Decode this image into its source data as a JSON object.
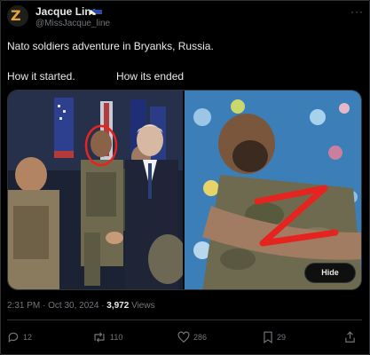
{
  "author": {
    "display_name": "Jacque Line",
    "handle": "@MissJacque_line",
    "avatar_letter": "Z"
  },
  "tweet": {
    "line1": "Nato soldiers adventure in Bryanks, Russia.",
    "label_left": "How it started.",
    "label_right": "How its ended"
  },
  "media": {
    "hide_label": "Hide"
  },
  "meta": {
    "time": "2:31 PM · Oct 30, 2024 · ",
    "views_count": "3,972",
    "views_label": " Views"
  },
  "actions": {
    "replies": "12",
    "reposts": "110",
    "likes": "286",
    "bookmarks": "29"
  },
  "colors": {
    "background": "#000000",
    "text": "#e7e9ea",
    "muted": "#71767b",
    "border": "#2f3336"
  }
}
